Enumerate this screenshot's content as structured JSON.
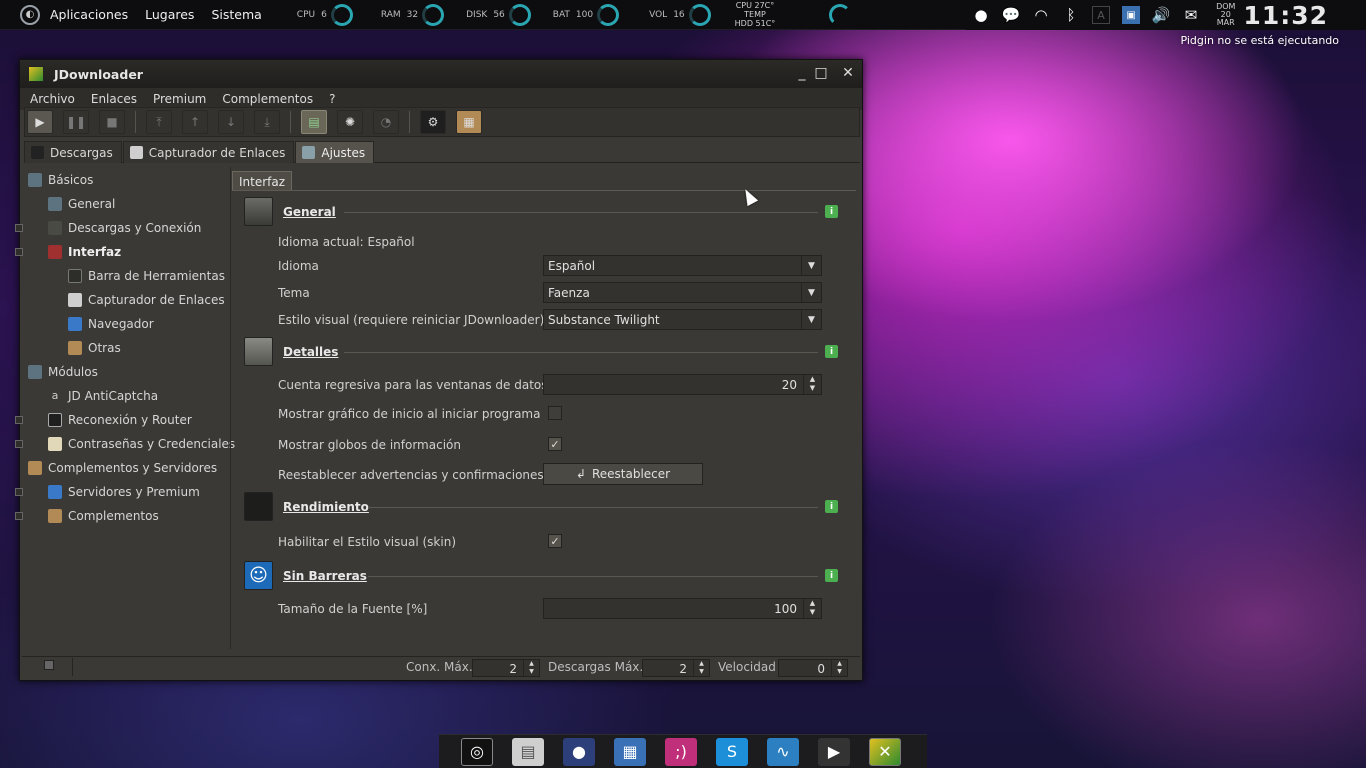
{
  "top_panel": {
    "menus": [
      "Aplicaciones",
      "Lugares",
      "Sistema"
    ],
    "monitors": [
      {
        "label": "CPU",
        "value": "6"
      },
      {
        "label": "RAM",
        "value": "32"
      },
      {
        "label": "DISK",
        "value": "56"
      },
      {
        "label": "BAT",
        "value": "100"
      },
      {
        "label": "VOL",
        "value": "16"
      }
    ],
    "stats": [
      "CPU 27C°",
      "TEMP",
      "HDD 51C°"
    ],
    "date": [
      "DOM",
      "20",
      "MAR"
    ],
    "clock": "11:32",
    "tray_icons": [
      "notification-icon",
      "chat-icon",
      "wifi-icon",
      "bluetooth-icon",
      "keyboard-icon",
      "display-icon",
      "volume-icon",
      "mail-icon"
    ]
  },
  "pidgin_notice": "Pidgin no se está ejecutando",
  "window": {
    "title": "JDownloader",
    "controls": [
      "_",
      "□",
      "✕"
    ],
    "menus": [
      "Archivo",
      "Enlaces",
      "Premium",
      "Complementos",
      "?"
    ],
    "tabs": [
      "Descargas",
      "Capturador de Enlaces",
      "Ajustes"
    ],
    "sidebar": {
      "basicos": "Básicos",
      "general": "General",
      "descargas": "Descargas y Conexión",
      "interfaz": "Interfaz",
      "barra": "Barra de Herramientas",
      "capturador": "Capturador de Enlaces",
      "navegador": "Navegador",
      "otras": "Otras",
      "modulos": "Módulos",
      "anticaptcha": "JD AntiCaptcha",
      "reconexion": "Reconexión y Router",
      "contrasenas": "Contraseñas y Credenciales",
      "complementos_servidores": "Complementos y Servidores",
      "servidores_premium": "Servidores y Premium",
      "complementos": "Complementos"
    },
    "content_tab": "Interfaz",
    "sections": {
      "general": {
        "title": "General",
        "idioma_actual": "Idioma actual: Español",
        "idioma_label": "Idioma",
        "idioma_value": "Español",
        "tema_label": "Tema",
        "tema_value": "Faenza",
        "estilo_label": "Estilo visual (requiere reiniciar JDownloader)",
        "estilo_value": "Substance Twilight"
      },
      "detalles": {
        "title": "Detalles",
        "cuenta_label": "Cuenta regresiva para las ventanas de datos",
        "cuenta_value": "20",
        "grafico_label": "Mostrar gráfico de inicio al iniciar programa",
        "grafico_checked": false,
        "globos_label": "Mostrar globos de información",
        "globos_checked": true,
        "reest_label": "Reestablecer advertencias y confirmaciones",
        "reest_button": "Reestablecer"
      },
      "rendimiento": {
        "title": "Rendimiento",
        "skin_label": "Habilitar el Estilo visual (skin)",
        "skin_checked": true
      },
      "sin_barreras": {
        "title": "Sin Barreras",
        "fuente_label": "Tamaño de la Fuente [%]",
        "fuente_value": "100"
      }
    },
    "statusbar": {
      "conx_label": "Conx. Máx.",
      "conx_value": "2",
      "desc_label": "Descargas Máx.",
      "desc_value": "2",
      "vel_label": "Velocidad",
      "vel_value": "0"
    }
  },
  "colors": {
    "accent": "#4caf50",
    "panel": "#0d0d0f",
    "window": "#3a3935"
  },
  "dock": [
    "disk-icon",
    "files-icon",
    "firefox-icon",
    "apps-icon",
    "chat-app-icon",
    "skype-icon",
    "monitor-icon",
    "video-icon",
    "jdownloader-icon"
  ]
}
